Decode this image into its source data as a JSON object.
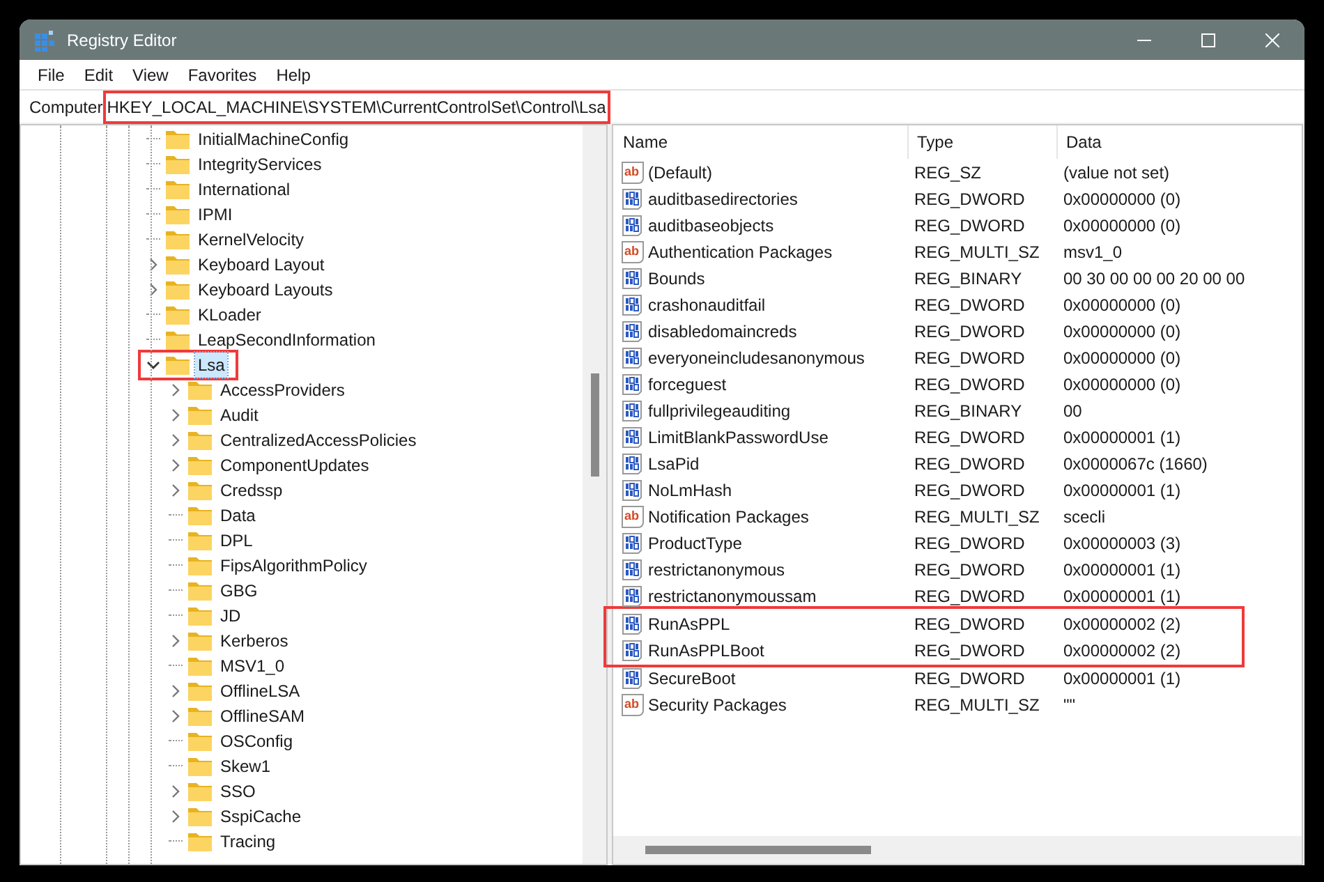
{
  "window": {
    "title": "Registry Editor"
  },
  "menu": [
    "File",
    "Edit",
    "View",
    "Favorites",
    "Help"
  ],
  "address_bar": {
    "prefix": "Computer",
    "path": "HKEY_LOCAL_MACHINE\\SYSTEM\\CurrentControlSet\\Control\\Lsa",
    "highlighted": true
  },
  "tree": [
    {
      "label": "InitialMachineConfig",
      "selected": false
    },
    {
      "label": "IntegrityServices",
      "selected": false
    },
    {
      "label": "International",
      "selected": false
    },
    {
      "label": "IPMI",
      "selected": false
    },
    {
      "label": "KernelVelocity",
      "selected": false
    },
    {
      "label": "Keyboard Layout",
      "expanded": false,
      "selected": false
    },
    {
      "label": "Keyboard Layouts",
      "expanded": false,
      "selected": false
    },
    {
      "label": "KLoader",
      "selected": false
    },
    {
      "label": "LeapSecondInformation",
      "selected": false
    },
    {
      "label": "Lsa",
      "expanded": true,
      "selected": true,
      "highlighted": true,
      "children": [
        {
          "label": "AccessProviders",
          "expanded": false,
          "selected": false
        },
        {
          "label": "Audit",
          "expanded": false,
          "selected": false
        },
        {
          "label": "CentralizedAccessPolicies",
          "expanded": false,
          "selected": false
        },
        {
          "label": "ComponentUpdates",
          "expanded": false,
          "selected": false
        },
        {
          "label": "Credssp",
          "expanded": false,
          "selected": false
        },
        {
          "label": "Data",
          "selected": false
        },
        {
          "label": "DPL",
          "selected": false
        },
        {
          "label": "FipsAlgorithmPolicy",
          "selected": false
        },
        {
          "label": "GBG",
          "selected": false
        },
        {
          "label": "JD",
          "selected": false
        },
        {
          "label": "Kerberos",
          "expanded": false,
          "selected": false
        },
        {
          "label": "MSV1_0",
          "selected": false
        },
        {
          "label": "OfflineLSA",
          "expanded": false,
          "selected": false
        },
        {
          "label": "OfflineSAM",
          "expanded": false,
          "selected": false
        },
        {
          "label": "OSConfig",
          "selected": false
        },
        {
          "label": "Skew1",
          "selected": false
        },
        {
          "label": "SSO",
          "expanded": false,
          "selected": false
        },
        {
          "label": "SspiCache",
          "expanded": false,
          "selected": false
        },
        {
          "label": "Tracing",
          "selected": false
        }
      ]
    }
  ],
  "table": {
    "columns": [
      "Name",
      "Type",
      "Data"
    ],
    "rows": [
      {
        "kind": "string",
        "icon_label": "ab",
        "name": "(Default)",
        "type": "REG_SZ",
        "data": "(value not set)"
      },
      {
        "kind": "binary",
        "name": "auditbasedirectories",
        "type": "REG_DWORD",
        "data": "0x00000000 (0)"
      },
      {
        "kind": "binary",
        "name": "auditbaseobjects",
        "type": "REG_DWORD",
        "data": "0x00000000 (0)"
      },
      {
        "kind": "string",
        "icon_label": "ab",
        "name": "Authentication Packages",
        "type": "REG_MULTI_SZ",
        "data": "msv1_0"
      },
      {
        "kind": "binary",
        "name": "Bounds",
        "type": "REG_BINARY",
        "data": "00 30 00 00 00 20 00 00"
      },
      {
        "kind": "binary",
        "name": "crashonauditfail",
        "type": "REG_DWORD",
        "data": "0x00000000 (0)"
      },
      {
        "kind": "binary",
        "name": "disabledomaincreds",
        "type": "REG_DWORD",
        "data": "0x00000000 (0)"
      },
      {
        "kind": "binary",
        "name": "everyoneincludesanonymous",
        "type": "REG_DWORD",
        "data": "0x00000000 (0)"
      },
      {
        "kind": "binary",
        "name": "forceguest",
        "type": "REG_DWORD",
        "data": "0x00000000 (0)"
      },
      {
        "kind": "binary",
        "name": "fullprivilegeauditing",
        "type": "REG_BINARY",
        "data": "00"
      },
      {
        "kind": "binary",
        "name": "LimitBlankPasswordUse",
        "type": "REG_DWORD",
        "data": "0x00000001 (1)"
      },
      {
        "kind": "binary",
        "name": "LsaPid",
        "type": "REG_DWORD",
        "data": "0x0000067c (1660)"
      },
      {
        "kind": "binary",
        "name": "NoLmHash",
        "type": "REG_DWORD",
        "data": "0x00000001 (1)"
      },
      {
        "kind": "string",
        "icon_label": "ab",
        "name": "Notification Packages",
        "type": "REG_MULTI_SZ",
        "data": "scecli"
      },
      {
        "kind": "binary",
        "name": "ProductType",
        "type": "REG_DWORD",
        "data": "0x00000003 (3)"
      },
      {
        "kind": "binary",
        "name": "restrictanonymous",
        "type": "REG_DWORD",
        "data": "0x00000001 (1)"
      },
      {
        "kind": "binary",
        "name": "restrictanonymoussam",
        "type": "REG_DWORD",
        "data": "0x00000001 (1)"
      },
      {
        "kind": "binary",
        "name": "RunAsPPL",
        "type": "REG_DWORD",
        "data": "0x00000002 (2)",
        "highlighted": true
      },
      {
        "kind": "binary",
        "name": "RunAsPPLBoot",
        "type": "REG_DWORD",
        "data": "0x00000002 (2)",
        "highlighted": true
      },
      {
        "kind": "binary",
        "name": "SecureBoot",
        "type": "REG_DWORD",
        "data": "0x00000001 (1)"
      },
      {
        "kind": "string",
        "icon_label": "ab",
        "name": "Security Packages",
        "type": "REG_MULTI_SZ",
        "data": "\"\""
      }
    ]
  }
}
